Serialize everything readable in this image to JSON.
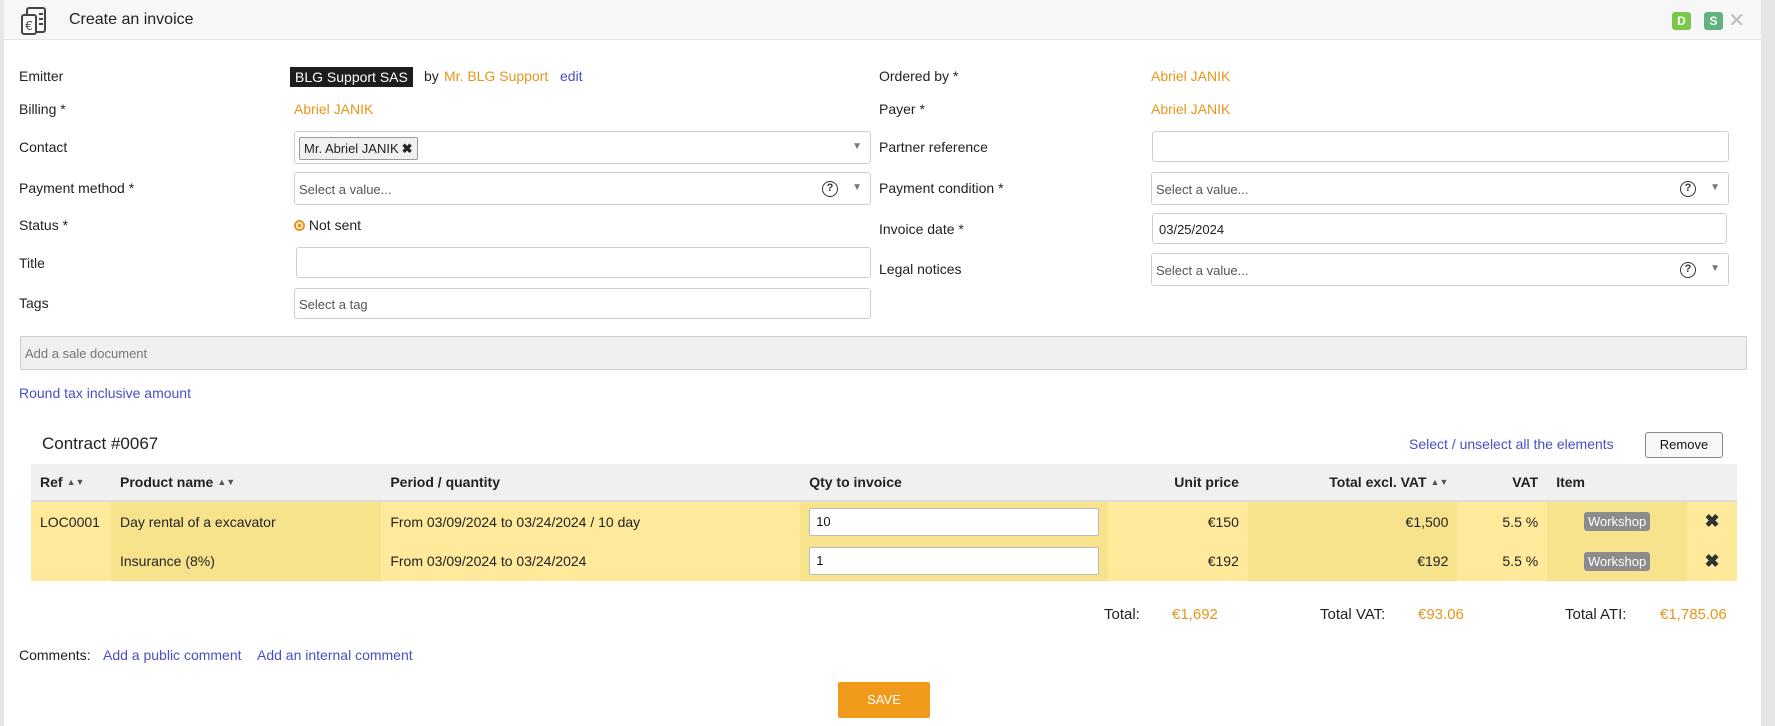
{
  "window": {
    "title": "Create an invoice",
    "badges": [
      {
        "label": "D",
        "color": "#7bc74a"
      },
      {
        "label": "S",
        "color": "#62b27f"
      }
    ],
    "close_label": "✕"
  },
  "form": {
    "emitter": {
      "label": "Emitter",
      "company": "BLG Support SAS",
      "by": "by",
      "person": "Mr. BLG Support",
      "edit": "edit"
    },
    "billing": {
      "label": "Billing *",
      "value": "Abriel JANIK"
    },
    "contact": {
      "label": "Contact",
      "chip": "Mr. Abriel JANIK",
      "chip_remove": "✖"
    },
    "payment_method": {
      "label": "Payment method *",
      "placeholder": "Select a value..."
    },
    "status": {
      "label": "Status *",
      "value": "Not sent"
    },
    "title": {
      "label": "Title",
      "value": ""
    },
    "tags": {
      "label": "Tags",
      "placeholder": "Select a tag"
    },
    "ordered_by": {
      "label": "Ordered by *",
      "value": "Abriel JANIK"
    },
    "payer": {
      "label": "Payer *",
      "value": "Abriel JANIK"
    },
    "partner_reference": {
      "label": "Partner reference",
      "value": ""
    },
    "payment_condition": {
      "label": "Payment condition *",
      "placeholder": "Select a value..."
    },
    "invoice_date": {
      "label": "Invoice date *",
      "value": "03/25/2024"
    },
    "legal_notices": {
      "label": "Legal notices",
      "placeholder": "Select a value..."
    }
  },
  "sale_document": {
    "placeholder": "Add a sale document"
  },
  "round_link": "Round tax inclusive amount",
  "contract": {
    "title": "Contract #0067",
    "select_all": "Select / unselect all the elements",
    "remove": "Remove",
    "columns": {
      "ref": "Ref",
      "product": "Product name",
      "period": "Period / quantity",
      "qty": "Qty to invoice",
      "unit_price": "Unit price",
      "total_excl": "Total excl. VAT",
      "vat": "VAT",
      "item": "Item"
    },
    "rows": [
      {
        "ref": "LOC0001",
        "product": "Day rental of a excavator",
        "period": "From 03/09/2024 to 03/24/2024 / 10 day",
        "qty": "10",
        "unit_price": "€150",
        "total_excl": "€1,500",
        "vat": "5.5 %",
        "item": "Workshop"
      },
      {
        "ref": "",
        "product": "Insurance (8%)",
        "period": "From 03/09/2024 to 03/24/2024",
        "qty": "1",
        "unit_price": "€192",
        "total_excl": "€192",
        "vat": "5.5 %",
        "item": "Workshop"
      }
    ]
  },
  "totals": {
    "total_label": "Total:",
    "total": "€1,692",
    "vat_label": "Total VAT:",
    "vat": "€93.06",
    "ati_label": "Total ATI:",
    "ati": "€1,785.06"
  },
  "comments": {
    "label": "Comments:",
    "public": "Add a public comment",
    "internal": "Add an internal comment"
  },
  "save_label": "SAVE",
  "colors": {
    "accent": "#e8951b",
    "link": "#4a4fc4",
    "row_highlight": "#ffe99a",
    "save": "#f09a1b"
  }
}
